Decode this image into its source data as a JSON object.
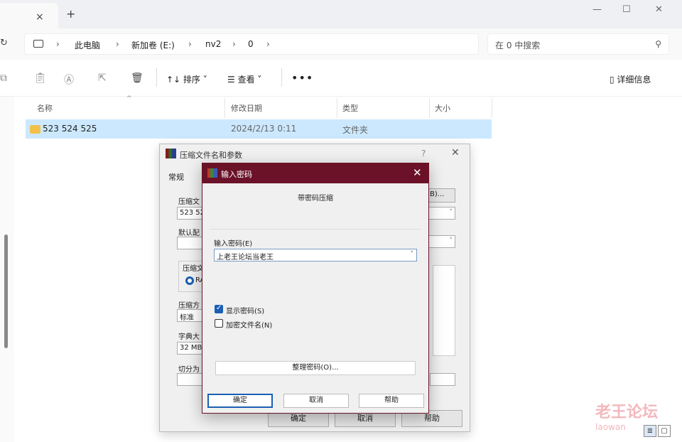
{
  "window": {
    "tab_close": "×",
    "new_tab": "+",
    "minimize": "—",
    "maximize": "☐",
    "close": "✕"
  },
  "address": {
    "refresh": "↻",
    "crumbs": [
      "此电脑",
      "新加卷 (E:)",
      "nv2",
      "0"
    ],
    "chevron": "›"
  },
  "search": {
    "placeholder": "在 0 中搜索",
    "icon": "search-icon"
  },
  "toolbar": {
    "sort_label": "↑↓ 排序 ˅",
    "view_label": "☰ 查看 ˅",
    "more_label": "•••",
    "details_label": "▯ 详细信息"
  },
  "columns": {
    "name": "名称",
    "date": "修改日期",
    "type": "类型",
    "size": "大小"
  },
  "files": [
    {
      "name": "523 524 525",
      "date": "2024/2/13 0:11",
      "type": "文件夹",
      "size": ""
    }
  ],
  "rar_dialog": {
    "title": "压缩文件名和参数",
    "help": "?",
    "close": "✕",
    "tab_general": "常规",
    "archive_name_label": "压缩文",
    "archive_name_value": "523 52",
    "browse_suffix": "B)...",
    "default_profile_label": "默认配",
    "format_label": "压缩文",
    "format_option": "RA",
    "method_label": "压缩方",
    "method_value": "标准",
    "dict_label": "字典大",
    "dict_value": "32 MB",
    "split_label": "切分为",
    "ok": "确定",
    "cancel": "取消",
    "help_btn": "帮助"
  },
  "password_dialog": {
    "title": "输入密码",
    "close": "✕",
    "heading": "带密码压缩",
    "input_label": "输入密码(E)",
    "input_value": "上老王论坛当老王",
    "show_password": "显示密码(S)",
    "show_password_checked": true,
    "encrypt_names": "加密文件名(N)",
    "encrypt_names_checked": false,
    "organize": "整理密码(O)...",
    "ok": "确定",
    "cancel": "取消",
    "help": "帮助"
  },
  "watermark": {
    "text": "老王论坛",
    "url": "laowan"
  },
  "view_buttons": {
    "details": "≣",
    "tiles": "▢"
  }
}
